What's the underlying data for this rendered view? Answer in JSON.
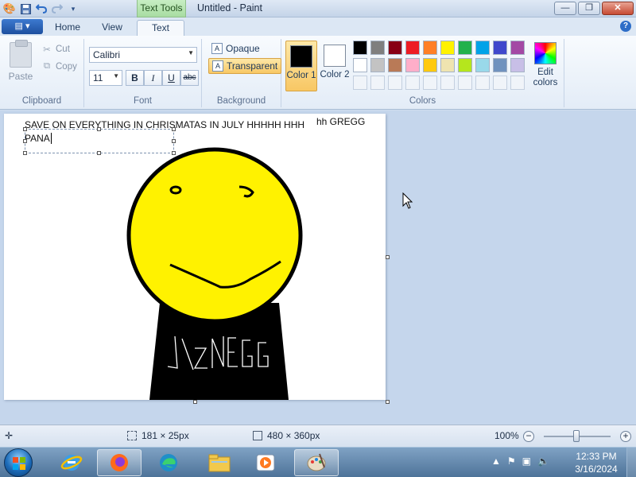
{
  "titlebar": {
    "contextual_tab": "Text Tools",
    "title": "Untitled - Paint",
    "minimize": "—",
    "maximize": "❐",
    "close": "✕",
    "qat_icons": [
      "paint-app-icon",
      "save-icon",
      "undo-icon",
      "redo-icon",
      "customize-dropdown-icon"
    ]
  },
  "tabs": {
    "app_menu": "▤ ▾",
    "home": "Home",
    "view": "View",
    "text": "Text",
    "help": "?"
  },
  "clipboard": {
    "paste": "Paste",
    "cut": "Cut",
    "copy": "Copy",
    "group_label": "Clipboard"
  },
  "font": {
    "family": "Calibri",
    "size": "11",
    "bold": "B",
    "italic": "I",
    "underline": "U",
    "strikethrough": "abc",
    "group_label": "Font"
  },
  "background": {
    "opaque": "Opaque",
    "transparent": "Transparent",
    "selected": "transparent",
    "group_label": "Background"
  },
  "colors": {
    "color1_label": "Color 1",
    "color2_label": "Color 2",
    "color1": "#000000",
    "color2": "#ffffff",
    "edit_label": "Edit colors",
    "group_label": "Colors",
    "palette_row1": [
      "#000000",
      "#7f7f7f",
      "#880015",
      "#ed1c24",
      "#ff7f27",
      "#fff200",
      "#22b14c",
      "#00a2e8",
      "#3f48cc",
      "#a349a4"
    ],
    "palette_row2": [
      "#ffffff",
      "#c3c3c3",
      "#b97a57",
      "#ffaec9",
      "#ffc90e",
      "#efe4b0",
      "#b5e61d",
      "#99d9ea",
      "#7092be",
      "#c8bfe7"
    ]
  },
  "canvas": {
    "line1": "SAVE ON EVERYTHING IN CHRISMATAS IN JULY HHHHH HHH",
    "line2": "PANA",
    "side_text": "hh GREGG",
    "shirt_scribble": "J\\ZNEGG"
  },
  "statusbar": {
    "selection_size": "181 × 25px",
    "canvas_size": "480 × 360px",
    "zoom": "100%",
    "zoom_level": 1.0
  },
  "taskbar": {
    "time": "12:33 PM",
    "date": "3/16/2024",
    "apps": [
      "internet-explorer-icon",
      "firefox-icon",
      "edge-icon",
      "file-explorer-icon",
      "media-player-icon",
      "paint-icon"
    ]
  }
}
